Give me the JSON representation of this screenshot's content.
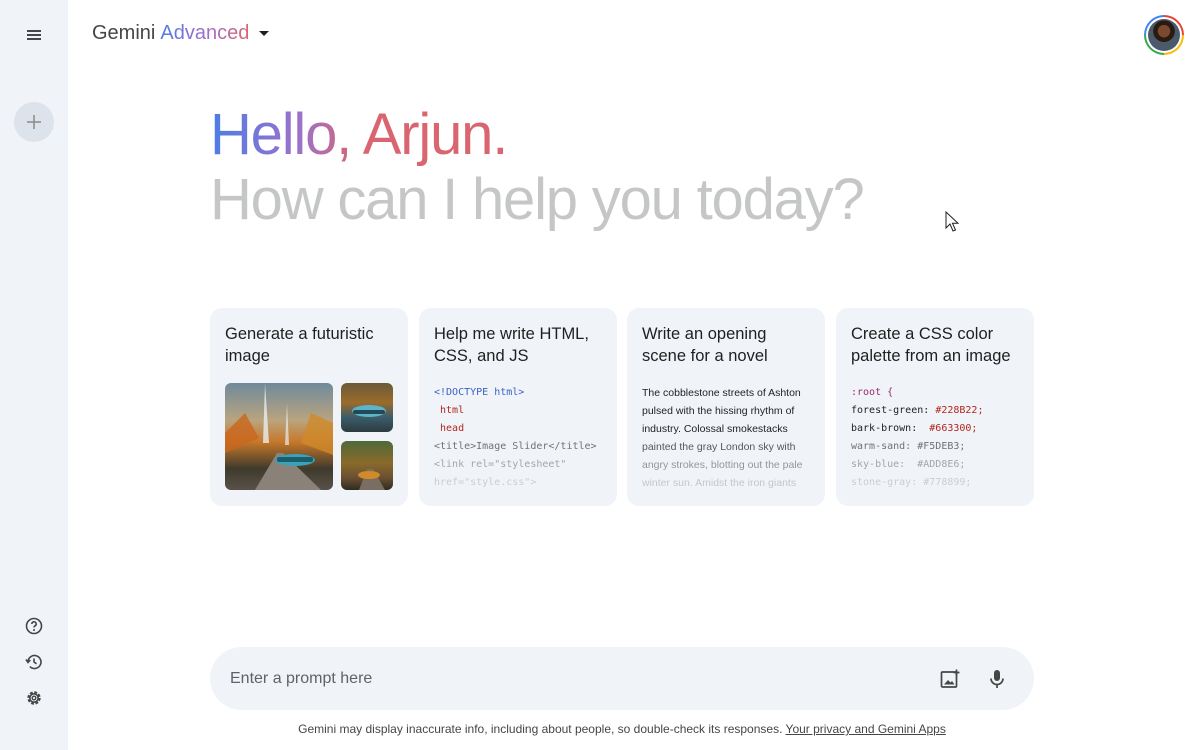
{
  "sidebar": {
    "menu_icon": "hamburger-menu-icon",
    "new_chat_icon": "plus-icon",
    "help_icon": "help-circle-icon",
    "activity_icon": "history-icon",
    "settings_icon": "gear-icon"
  },
  "header": {
    "title": "Gemini",
    "tier": "Advanced",
    "dropdown_icon": "caret-down-icon"
  },
  "greeting": {
    "line1": "Hello, Arjun.",
    "line2": "How can I help you today?"
  },
  "cards": [
    {
      "title": "Generate a futuristic image"
    },
    {
      "title": "Help me write HTML, CSS, and JS",
      "code": [
        "<!DOCTYPE html>",
        " html",
        " head",
        "<title>Image Slider</title>",
        "<link rel=\"stylesheet\"",
        "href=\"style.css\">"
      ]
    },
    {
      "title": "Write an opening scene for a novel",
      "lines": [
        "The cobblestone streets of Ashton",
        "pulsed with the hissing rhythm of",
        "industry. Colossal smokestacks",
        "painted the gray London sky with",
        "angry strokes, blotting out the pale",
        "winter sun. Amidst the iron giants"
      ]
    },
    {
      "title": "Create a CSS color palette from an image",
      "root": ":root {",
      "vars": [
        {
          "name": "forest-green:",
          "value": "#228B22;"
        },
        {
          "name": "bark-brown:",
          "value": "#663300;"
        },
        {
          "name": "warm-sand:",
          "value": "#F5DEB3;"
        },
        {
          "name": "sky-blue:",
          "value": "#ADD8E6;"
        },
        {
          "name": "stone-gray:",
          "value": "#778899;"
        }
      ]
    }
  ],
  "prompt": {
    "placeholder": "Enter a prompt here",
    "image_icon": "add-image-icon",
    "mic_icon": "microphone-icon"
  },
  "footer": {
    "text": "Gemini may display inaccurate info, including about people, so double-check its responses.",
    "link": "Your privacy and Gemini Apps"
  },
  "colors": {
    "sidebar_bg": "#f0f4f9",
    "card_bg": "#f0f4f9",
    "greeting_gradient": [
      "#4b7de6",
      "#9b72cb",
      "#d96570"
    ],
    "muted_text": "#c4c7c5"
  }
}
